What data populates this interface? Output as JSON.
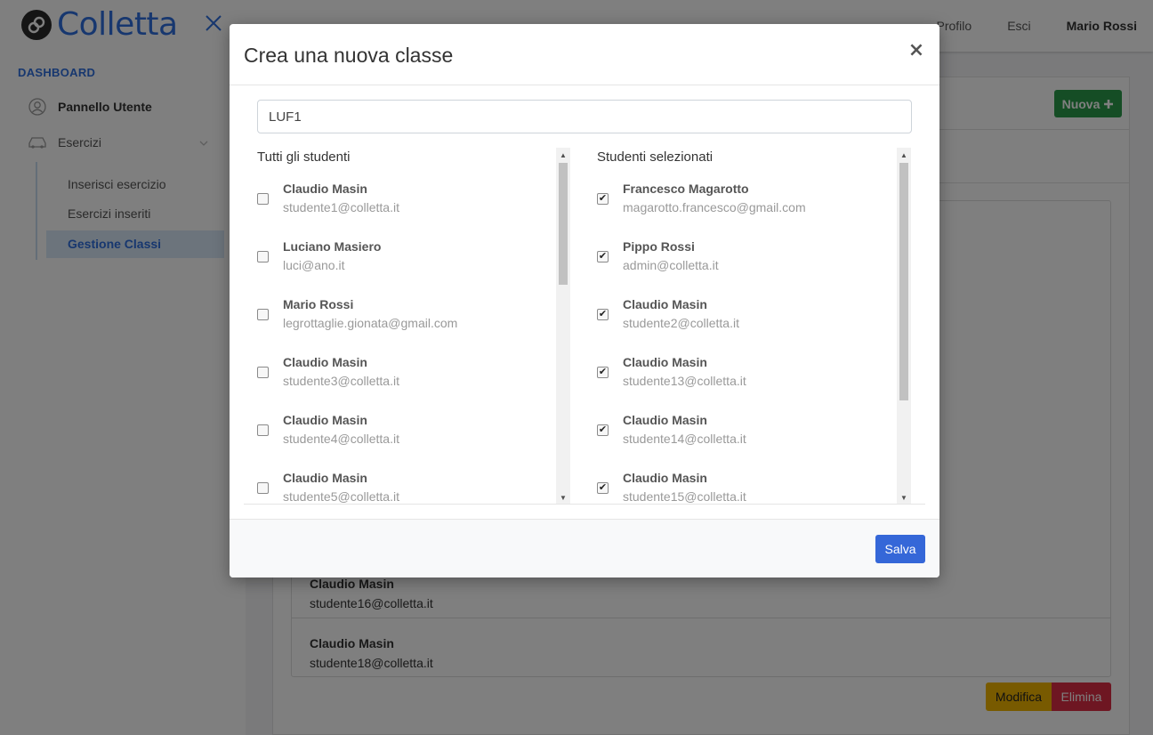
{
  "app": {
    "brand": "Colletta",
    "nav_links": [
      "Profilo",
      "Esci"
    ],
    "user": "Mario Rossi"
  },
  "sidebar": {
    "heading": "DASHBOARD",
    "items": [
      {
        "label": "Pannello Utente",
        "icon": "user-circle-icon"
      },
      {
        "label": "Esercizi",
        "icon": "car-icon"
      }
    ],
    "subitems": [
      "Inserisci esercizio",
      "Esercizi inseriti",
      "Gestione Classi"
    ],
    "active_subitem": "Gestione Classi"
  },
  "content": {
    "new_button": "Nuova",
    "list": [
      {
        "name": "Claudio Masin",
        "email": "studente16@colletta.it"
      },
      {
        "name": "Claudio Masin",
        "email": "studente18@colletta.it"
      }
    ],
    "edit_button": "Modifica",
    "delete_button": "Elimina",
    "colors": {
      "new": "#2b9a4a",
      "edit": "#f0b400",
      "delete": "#dc2c44"
    }
  },
  "modal": {
    "title": "Crea una nuova classe",
    "close_glyph": "×",
    "class_name_value": "LUF1",
    "all_students_title": "Tutti gli studenti",
    "selected_students_title": "Studenti selezionati",
    "all_students": [
      {
        "name": "Claudio Masin",
        "email": "studente1@colletta.it",
        "checked": false
      },
      {
        "name": "Luciano Masiero",
        "email": "luci@ano.it",
        "checked": false
      },
      {
        "name": "Mario Rossi",
        "email": "legrottaglie.gionata@gmail.com",
        "checked": false
      },
      {
        "name": "Claudio Masin",
        "email": "studente3@colletta.it",
        "checked": false
      },
      {
        "name": "Claudio Masin",
        "email": "studente4@colletta.it",
        "checked": false
      },
      {
        "name": "Claudio Masin",
        "email": "studente5@colletta.it",
        "checked": false
      }
    ],
    "selected_students": [
      {
        "name": "Francesco Magarotto",
        "email": "magarotto.francesco@gmail.com",
        "checked": true
      },
      {
        "name": "Pippo Rossi",
        "email": "admin@colletta.it",
        "checked": true
      },
      {
        "name": "Claudio Masin",
        "email": "studente2@colletta.it",
        "checked": true
      },
      {
        "name": "Claudio Masin",
        "email": "studente13@colletta.it",
        "checked": true
      },
      {
        "name": "Claudio Masin",
        "email": "studente14@colletta.it",
        "checked": true
      },
      {
        "name": "Claudio Masin",
        "email": "studente15@colletta.it",
        "checked": true
      }
    ],
    "save_button": "Salva",
    "save_color": "#3567d8"
  }
}
